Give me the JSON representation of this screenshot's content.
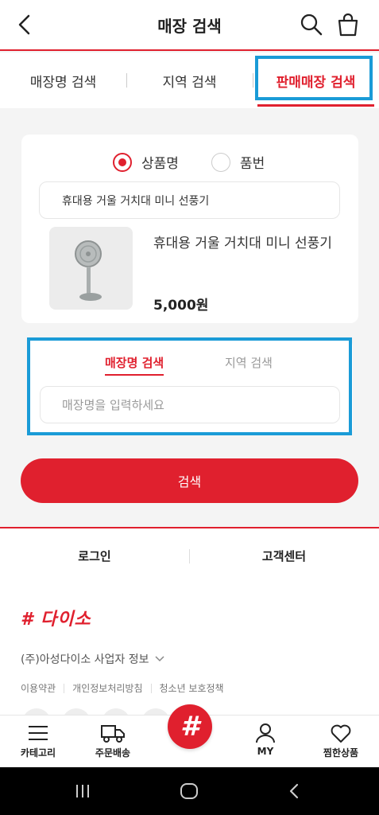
{
  "header": {
    "title": "매장 검색"
  },
  "top_tabs": [
    {
      "label": "매장명 검색"
    },
    {
      "label": "지역 검색"
    },
    {
      "label": "판매매장 검색"
    }
  ],
  "product_search": {
    "radios": [
      {
        "label": "상품명",
        "checked": true
      },
      {
        "label": "품번",
        "checked": false
      }
    ],
    "input_value": "휴대용 거울 거치대 미니 선풍기",
    "product": {
      "name": "휴대용 거울 거치대 미니 선풍기",
      "price": "5,000원"
    }
  },
  "store_search": {
    "tabs": [
      {
        "label": "매장명 검색"
      },
      {
        "label": "지역 검색"
      }
    ],
    "placeholder": "매장명을 입력하세요"
  },
  "search_button": "검색",
  "footer_links": [
    {
      "label": "로그인"
    },
    {
      "label": "고객센터"
    }
  ],
  "company": {
    "logo": "# 다이소",
    "biz_info": "(주)아성다이소 사업자 정보",
    "policies": [
      "이용약관",
      "개인정보처리방침",
      "청소년 보호정책"
    ]
  },
  "bottom_nav": [
    {
      "label": "카테고리",
      "icon": "menu-icon"
    },
    {
      "label": "주문배송",
      "icon": "truck-icon"
    },
    {
      "label": "#",
      "icon": "home-hash-icon"
    },
    {
      "label": "MY",
      "icon": "person-icon"
    },
    {
      "label": "찜한상품",
      "icon": "heart-icon"
    }
  ],
  "colors": {
    "accent": "#e0202e",
    "highlight": "#1a9bd7"
  }
}
